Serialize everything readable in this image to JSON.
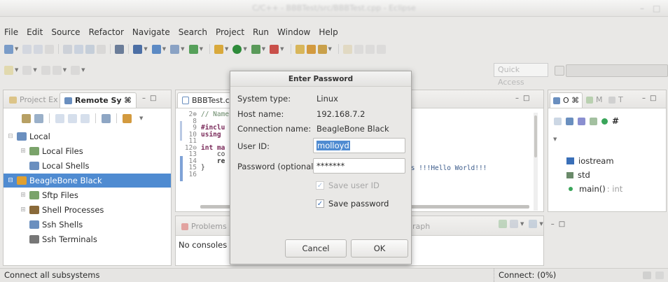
{
  "window": {
    "title": "C/C++ - BBBTest/src/BBBTest.cpp - Eclipse"
  },
  "menu": [
    "File",
    "Edit",
    "Source",
    "Refactor",
    "Navigate",
    "Search",
    "Project",
    "Run",
    "Window",
    "Help"
  ],
  "quick_access": {
    "placeholder": "Quick Access"
  },
  "left_panel": {
    "tabs": [
      "Project Ex",
      "Remote Sy ⌘"
    ],
    "tree": [
      {
        "label": "Local",
        "indent": 0,
        "toggle": "⊟"
      },
      {
        "label": "Local Files",
        "indent": 1,
        "toggle": "⊞"
      },
      {
        "label": "Local Shells",
        "indent": 1,
        "toggle": ""
      },
      {
        "label": "BeagleBone Black",
        "indent": 0,
        "toggle": "⊟",
        "selected": true
      },
      {
        "label": "Sftp Files",
        "indent": 1,
        "toggle": "⊞"
      },
      {
        "label": "Shell Processes",
        "indent": 1,
        "toggle": "⊞"
      },
      {
        "label": "Ssh Shells",
        "indent": 1,
        "toggle": ""
      },
      {
        "label": "Ssh Terminals",
        "indent": 1,
        "toggle": ""
      }
    ]
  },
  "editor": {
    "tab": "BBBTest.c",
    "gutter": [
      "2⊕",
      "8",
      "9",
      "10",
      "11",
      "12⊖",
      "13",
      "14",
      "15",
      "16"
    ],
    "lines": [
      "// Name",
      "",
      "#inclu",
      "using",
      "",
      "int ma",
      "    co",
      "    re",
      "}",
      ""
    ],
    "visible_right": "ts !!!Hello World!!!"
  },
  "console": {
    "tab": "Problems",
    "text": "No consoles t",
    "right_fragment": "raph"
  },
  "outline": {
    "tabs": [
      "O ⌘",
      "M",
      "T"
    ],
    "items": [
      {
        "label": "iostream",
        "extra": ""
      },
      {
        "label": "std",
        "extra": ""
      },
      {
        "label": "main()",
        "extra": ": int"
      }
    ]
  },
  "dialog": {
    "title": "Enter Password",
    "system_type_label": "System type:",
    "system_type_value": "Linux",
    "host_name_label": "Host name:",
    "host_name_value": "192.168.7.2",
    "connection_name_label": "Connection name:",
    "connection_name_value": "BeagleBone Black",
    "user_id_label": "User ID:",
    "user_id_value": "molloyd",
    "password_label": "Password (optional):",
    "password_value": "*******",
    "save_user_id": {
      "label": "Save user ID",
      "checked": true,
      "enabled": false
    },
    "save_password": {
      "label": "Save password",
      "checked": true,
      "enabled": true
    },
    "cancel": "Cancel",
    "ok": "OK"
  },
  "status": {
    "left": "Connect all subsystems",
    "right": "Connect: (0%)"
  },
  "colors": {
    "selection": "#4f8bd1",
    "accent_blue": "#3a6fb8"
  }
}
